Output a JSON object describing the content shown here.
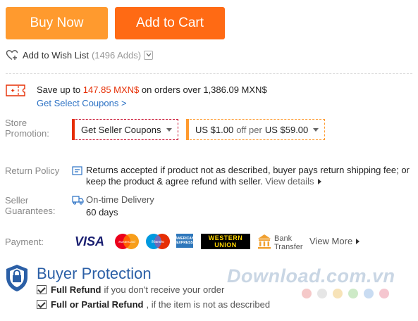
{
  "actions": {
    "buy_now": "Buy Now",
    "add_to_cart": "Add to Cart"
  },
  "wishlist": {
    "label": "Add to Wish List",
    "adds": "(1496 Adds)"
  },
  "coupon": {
    "save_prefix": "Save up to",
    "save_amount": "147.85 MXN$",
    "save_suffix": "on orders over 1,386.09 MXN$",
    "link": "Get Select Coupons >"
  },
  "store_promotion": {
    "label": "Store Promotion:",
    "seller_coupons": "Get Seller Coupons",
    "promo_amount": "US $1.00",
    "promo_off": "off per",
    "promo_threshold": "US $59.00"
  },
  "return_policy": {
    "label": "Return Policy",
    "text": "Returns accepted if product not as described, buyer pays return shipping fee; or keep the product & agree refund with seller.",
    "view_details": "View details"
  },
  "seller_guarantees": {
    "label": "Seller Guarantees:",
    "delivery": "On-time Delivery",
    "days": "60 days"
  },
  "payment": {
    "label": "Payment:",
    "visa": "VISA",
    "mastercard": "MasterCard",
    "maestro": "Maestro",
    "amex_line1": "AMERICAN",
    "amex_line2": "EXPRESS",
    "wu_line1": "WESTERN",
    "wu_line2": "UNION",
    "bank_line1": "Bank",
    "bank_line2": "Transfer",
    "view_more": "View More"
  },
  "buyer_protection": {
    "title": "Buyer Protection",
    "full_refund": "Full Refund",
    "full_refund_desc": "if you don't receive your order",
    "partial_refund": "Full or Partial Refund",
    "partial_refund_desc": ", if the item is not as described"
  },
  "watermark": {
    "text": "Download.com.vn"
  },
  "colors": {
    "buy_now": "#ff9a2e",
    "add_to_cart": "#ff6a14",
    "price_red": "#e62e04",
    "link_blue": "#2b71c4",
    "protection_blue": "#2b5fa6",
    "watermark_dots": [
      "#f5c9c9",
      "#e6e6e6",
      "#f7e3b8",
      "#cdeac7",
      "#c9dcf2",
      "#f5c6cf"
    ]
  },
  "icons": {
    "wishlist": "heart-plus-icon",
    "coupon": "coupon-ticket-icon",
    "return": "return-box-icon",
    "delivery": "truck-icon",
    "bank": "bank-building-icon",
    "protection": "shield-icon"
  }
}
